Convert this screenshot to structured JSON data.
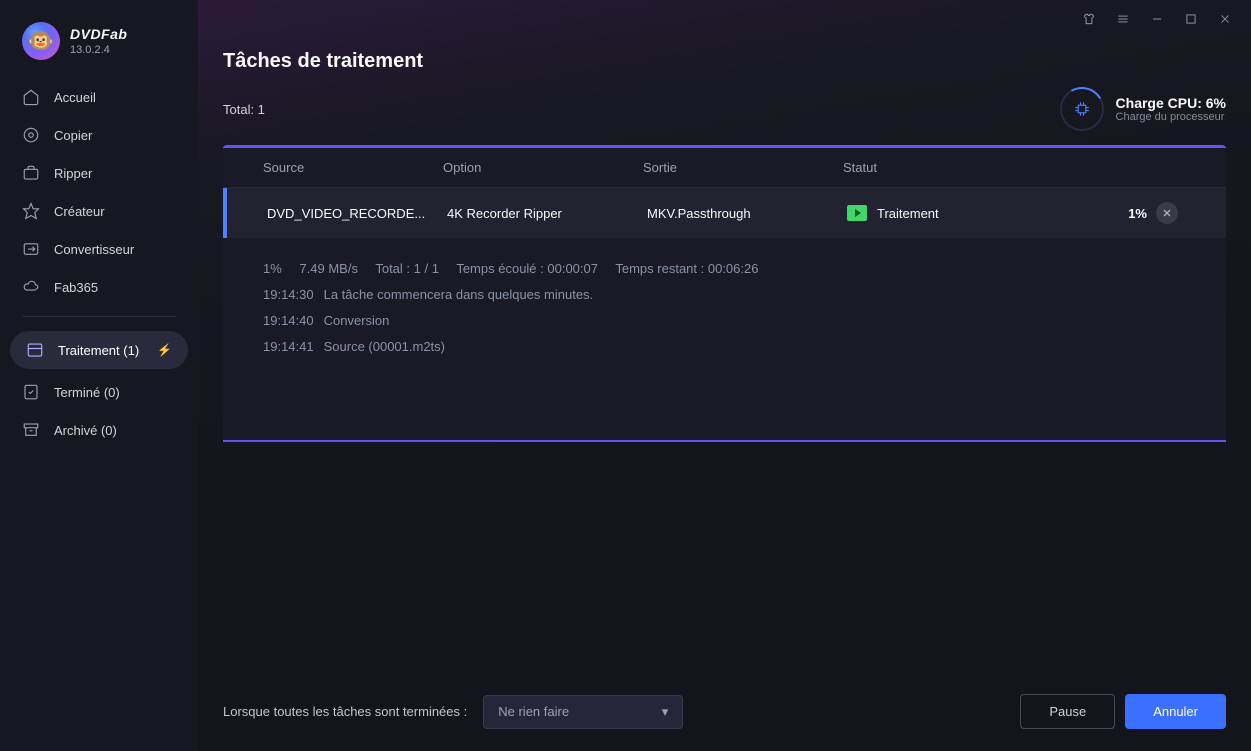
{
  "app": {
    "name": "DVDFab",
    "version": "13.0.2.4"
  },
  "sidebar": {
    "items": [
      {
        "label": "Accueil",
        "icon": "home"
      },
      {
        "label": "Copier",
        "icon": "disc"
      },
      {
        "label": "Ripper",
        "icon": "briefcase"
      },
      {
        "label": "Créateur",
        "icon": "star"
      },
      {
        "label": "Convertisseur",
        "icon": "convert"
      },
      {
        "label": "Fab365",
        "icon": "cloud"
      }
    ],
    "secondary": [
      {
        "label": "Traitement (1)",
        "icon": "tasks",
        "active": true
      },
      {
        "label": "Terminé (0)",
        "icon": "check"
      },
      {
        "label": "Archivé (0)",
        "icon": "archive"
      }
    ]
  },
  "page": {
    "title": "Tâches de traitement",
    "total": "Total: 1",
    "cpu": {
      "label": "Charge CPU: 6%",
      "sub": "Charge du processeur"
    }
  },
  "table": {
    "headers": {
      "source": "Source",
      "option": "Option",
      "sortie": "Sortie",
      "statut": "Statut"
    },
    "row": {
      "source": "DVD_VIDEO_RECORDE...",
      "option": "4K Recorder Ripper",
      "sortie": "MKV.Passthrough",
      "statut": "Traitement",
      "percent": "1%"
    }
  },
  "log": {
    "stats": {
      "pct": "1%",
      "speed": "7.49 MB/s",
      "total": "Total : 1 / 1",
      "elapsed": "Temps écoulé : 00:00:07",
      "remaining": "Temps restant : 00:06:26"
    },
    "lines": [
      {
        "t": "19:14:30",
        "m": "La tâche commencera dans quelques minutes."
      },
      {
        "t": "19:14:40",
        "m": "Conversion"
      },
      {
        "t": "19:14:41",
        "m": "Source (00001.m2ts)"
      }
    ]
  },
  "footer": {
    "label": "Lorsque toutes les tâches sont terminées :",
    "select": "Ne rien faire",
    "pause": "Pause",
    "cancel": "Annuler"
  }
}
